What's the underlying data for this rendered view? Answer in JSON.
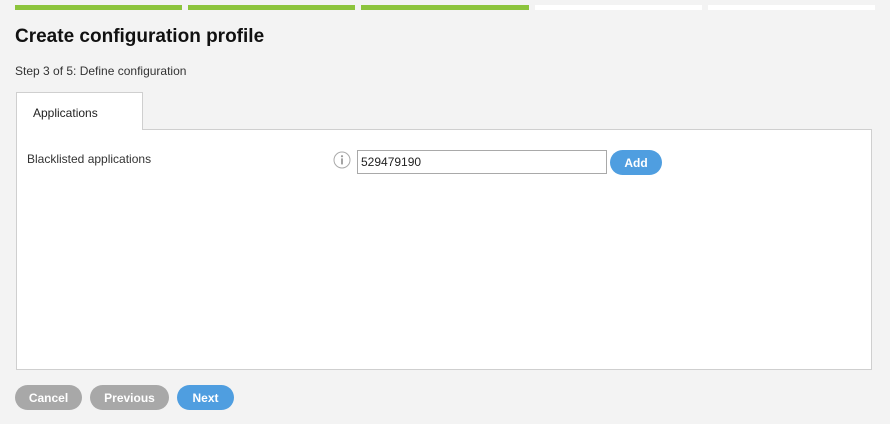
{
  "wizard": {
    "steps": [
      {
        "state": "done"
      },
      {
        "state": "done"
      },
      {
        "state": "done"
      },
      {
        "state": "pending"
      },
      {
        "state": "pending"
      }
    ],
    "title": "Create configuration profile",
    "step_label": "Step 3 of 5: Define configuration"
  },
  "tabs": [
    {
      "label": "Applications",
      "active": true
    }
  ],
  "form": {
    "blacklisted_label": "Blacklisted applications",
    "info_icon": "info-icon",
    "blacklisted_value": "529479190",
    "add_label": "Add"
  },
  "footer": {
    "cancel_label": "Cancel",
    "previous_label": "Previous",
    "next_label": "Next"
  },
  "colors": {
    "progress_done": "#8cc43c",
    "progress_pending": "#ffffff",
    "primary_button": "#4f9ee0",
    "secondary_button": "#a8a8a8",
    "background": "#f3f3f3"
  }
}
